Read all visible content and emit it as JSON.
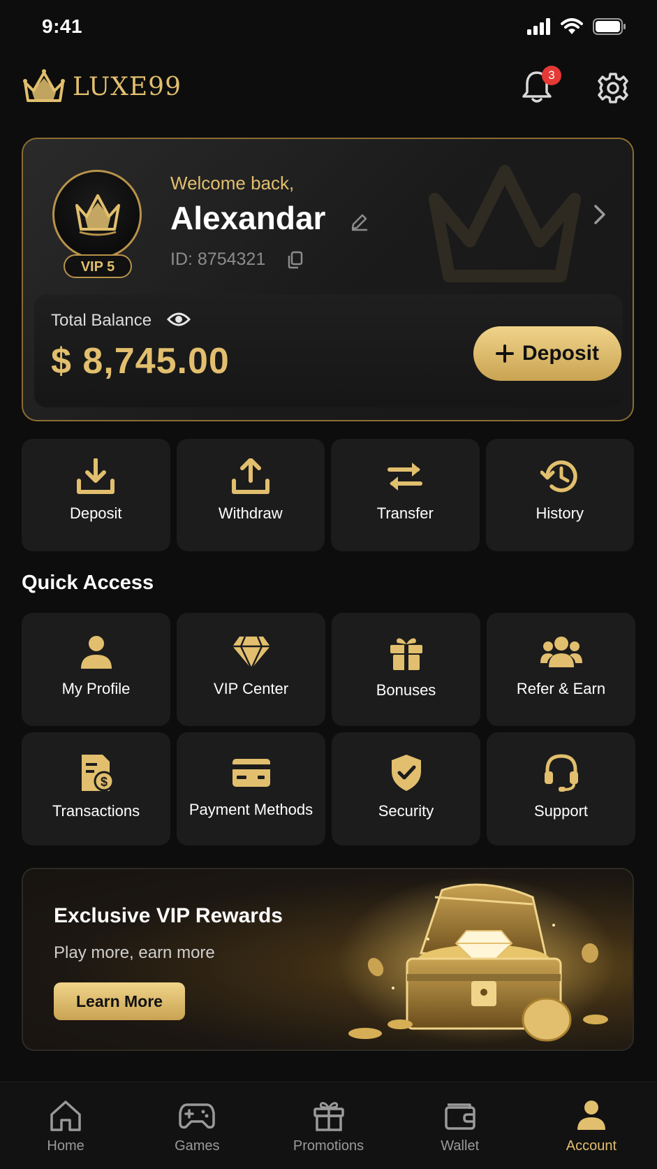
{
  "status_bar": {
    "time": "9:41"
  },
  "header": {
    "brand": "LUXE99",
    "notification_count": "3"
  },
  "profile": {
    "welcome": "Welcome back,",
    "name": "Alexandar",
    "id_text": "ID: 8754321",
    "vip_level": "VIP 5"
  },
  "balance": {
    "label": "Total Balance",
    "value": "$ 8,745.00",
    "deposit_label": "Deposit"
  },
  "actions": [
    {
      "label": "Deposit",
      "icon": "download-icon"
    },
    {
      "label": "Withdraw",
      "icon": "upload-icon"
    },
    {
      "label": "Transfer",
      "icon": "transfer-arrows-icon"
    },
    {
      "label": "History",
      "icon": "history-clock-icon"
    }
  ],
  "quick_access": {
    "title": "Quick Access",
    "items": [
      {
        "label": "My Profile",
        "icon": "user-icon"
      },
      {
        "label": "VIP Center",
        "icon": "diamond-icon"
      },
      {
        "label": "Bonuses",
        "icon": "gift-icon"
      },
      {
        "label": "Refer & Earn",
        "icon": "users-icon"
      },
      {
        "label": "Transactions",
        "icon": "receipt-dollar-icon"
      },
      {
        "label": "Payment Methods",
        "icon": "credit-card-icon"
      },
      {
        "label": "Security",
        "icon": "shield-check-icon"
      },
      {
        "label": "Support",
        "icon": "headset-icon"
      }
    ]
  },
  "promo": {
    "title": "Exclusive VIP Rewards",
    "subtitle": "Play more, earn more",
    "button": "Learn More"
  },
  "bottom_nav": [
    {
      "label": "Home",
      "icon": "home-icon",
      "active": false
    },
    {
      "label": "Games",
      "icon": "gamepad-icon",
      "active": false
    },
    {
      "label": "Promotions",
      "icon": "gift-icon",
      "active": false
    },
    {
      "label": "Wallet",
      "icon": "wallet-icon",
      "active": false
    },
    {
      "label": "Account",
      "icon": "user-icon",
      "active": true
    }
  ],
  "colors": {
    "accent": "#e2bf6e",
    "background": "#0d0d0d",
    "tile": "#1c1c1c",
    "badge": "#e53935"
  }
}
